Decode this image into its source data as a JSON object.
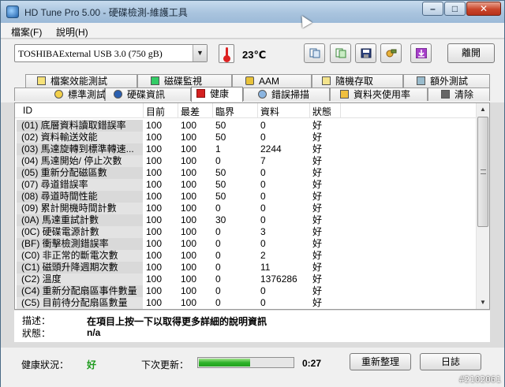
{
  "window": {
    "title": "HD Tune Pro 5.00 - 硬碟檢測-維護工具"
  },
  "menu": [
    "檔案(F)",
    "說明(H)"
  ],
  "toolbar": {
    "drive": "TOSHIBAExternal USB 3.0 (750 gB)",
    "temperature": "23℃",
    "exit_label": "離開",
    "buttons": [
      "copy-info-icon",
      "copy-screen-icon",
      "save-icon",
      "options-icon",
      "download-icon"
    ]
  },
  "tabs": {
    "row1": [
      {
        "label": "檔案效能測試",
        "icon": "file-benchmark-icon"
      },
      {
        "label": "磁碟監視",
        "icon": "disk-monitor-icon"
      },
      {
        "label": "AAM",
        "icon": "speaker-icon"
      },
      {
        "label": "隨機存取",
        "icon": "random-access-icon"
      },
      {
        "label": "額外測試",
        "icon": "extra-tests-icon"
      }
    ],
    "row2": [
      {
        "label": "標準測試",
        "icon": "benchmark-icon"
      },
      {
        "label": "硬碟資訊",
        "icon": "info-icon"
      },
      {
        "label": "健康",
        "icon": "health-cross-icon"
      },
      {
        "label": "錯誤掃描",
        "icon": "error-scan-icon"
      },
      {
        "label": "資料夾使用率",
        "icon": "folder-usage-icon"
      },
      {
        "label": "清除",
        "icon": "erase-icon"
      }
    ]
  },
  "table": {
    "columns": [
      "ID",
      "目前",
      "最差",
      "臨界",
      "資料",
      "狀態"
    ],
    "rows": [
      [
        "(01) 底層資料讀取錯誤率",
        "100",
        "100",
        "50",
        "0",
        "好"
      ],
      [
        "(02) 資料輸送效能",
        "100",
        "100",
        "50",
        "0",
        "好"
      ],
      [
        "(03) 馬達旋轉到標準轉速...",
        "100",
        "100",
        "1",
        "2244",
        "好"
      ],
      [
        "(04) 馬達開始/ 停止次數",
        "100",
        "100",
        "0",
        "7",
        "好"
      ],
      [
        "(05) 重新分配磁區數",
        "100",
        "100",
        "50",
        "0",
        "好"
      ],
      [
        "(07) 尋道錯誤率",
        "100",
        "100",
        "50",
        "0",
        "好"
      ],
      [
        "(08) 尋道時間性能",
        "100",
        "100",
        "50",
        "0",
        "好"
      ],
      [
        "(09) 累計開機時間計數",
        "100",
        "100",
        "0",
        "0",
        "好"
      ],
      [
        "(0A) 馬達重試計數",
        "100",
        "100",
        "30",
        "0",
        "好"
      ],
      [
        "(0C) 硬碟電源計數",
        "100",
        "100",
        "0",
        "3",
        "好"
      ],
      [
        "(BF) 衝擊檢測錯誤率",
        "100",
        "100",
        "0",
        "0",
        "好"
      ],
      [
        "(C0) 非正常的斷電次數",
        "100",
        "100",
        "0",
        "2",
        "好"
      ],
      [
        "(C1) 磁頭升降週期次數",
        "100",
        "100",
        "0",
        "11",
        "好"
      ],
      [
        "(C2) 溫度",
        "100",
        "100",
        "0",
        "1376286",
        "好"
      ],
      [
        "(C4) 重新分配扇區事件數量",
        "100",
        "100",
        "0",
        "0",
        "好"
      ],
      [
        "(C5) 目前待分配扇區數量",
        "100",
        "100",
        "0",
        "0",
        "好"
      ]
    ]
  },
  "description": {
    "desc_label": "描述：",
    "desc_value": "在項目上按一下以取得更多詳細的說明資訊",
    "status_label": "狀態：",
    "status_value": "n/a"
  },
  "status": {
    "health_label": "健康狀況：",
    "health_value": "好",
    "next_update_label": "下次更新：",
    "progress": 0.55,
    "countdown": "0:27",
    "refresh_label": "重新整理",
    "log_label": "日誌"
  },
  "watermark": "#2102061"
}
